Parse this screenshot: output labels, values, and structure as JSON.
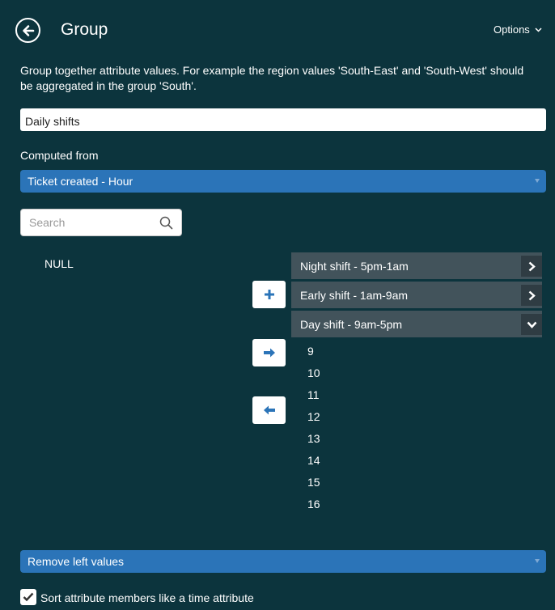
{
  "header": {
    "title": "Group",
    "options_label": "Options"
  },
  "description": "Group together attribute values. For example the region values 'South-East' and 'South-West' should be aggregated in the group 'South'.",
  "group_name": {
    "value": "Daily shifts"
  },
  "computed_from": {
    "label": "Computed from",
    "selected": "Ticket created - Hour"
  },
  "search": {
    "placeholder": "Search"
  },
  "left_values": [
    "NULL"
  ],
  "groups": [
    {
      "label": "Night shift - 5pm-1am",
      "expanded": false
    },
    {
      "label": "Early shift - 1am-9am",
      "expanded": false
    },
    {
      "label": "Day shift - 9am-5pm",
      "expanded": true
    }
  ],
  "expanded_members": [
    "9",
    "10",
    "11",
    "12",
    "13",
    "14",
    "15",
    "16"
  ],
  "remove_left": {
    "selected": "Remove left values"
  },
  "sort_option": {
    "label": "Sort attribute members like a time attribute",
    "checked": true
  },
  "icons": {
    "back": "arrow-left-circle-icon",
    "options": "chevron-down-icon",
    "search": "search-icon",
    "add": "plus-icon",
    "move_right": "arrow-right-icon",
    "move_left": "arrow-left-icon",
    "collapsed": "chevron-right-icon",
    "expanded": "chevron-down-icon",
    "check": "check-icon"
  },
  "colors": {
    "background": "#0c343d",
    "accent_blue": "#2b74b8",
    "group_row": "#42535b",
    "button_icon": "#2b74b8"
  }
}
